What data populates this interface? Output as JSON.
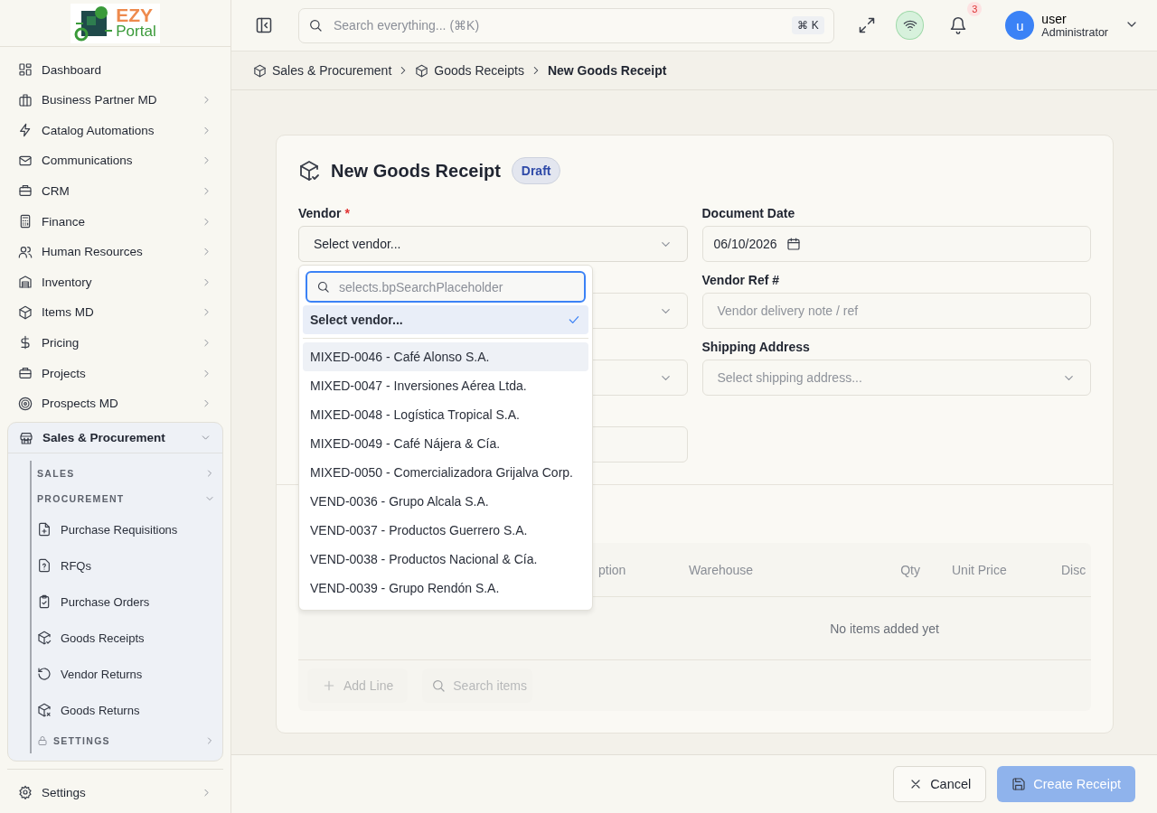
{
  "sidebar": {
    "logo": {
      "line_1": "EZY",
      "line_2": "Portal"
    },
    "items": [
      {
        "label": "Dashboard",
        "expandable": false
      },
      {
        "label": "Business Partner MD",
        "expandable": true
      },
      {
        "label": "Catalog Automations",
        "expandable": true
      },
      {
        "label": "Communications",
        "expandable": true
      },
      {
        "label": "CRM",
        "expandable": true
      },
      {
        "label": "Finance",
        "expandable": true
      },
      {
        "label": "Human Resources",
        "expandable": true
      },
      {
        "label": "Inventory",
        "expandable": true
      },
      {
        "label": "Items MD",
        "expandable": true
      },
      {
        "label": "Pricing",
        "expandable": true
      },
      {
        "label": "Projects",
        "expandable": true
      },
      {
        "label": "Prospects MD",
        "expandable": true
      }
    ],
    "group": {
      "label": "Sales & Procurement",
      "expanded": true,
      "sections": [
        {
          "label": "SALES",
          "expanded": false,
          "locked": false
        },
        {
          "label": "PROCUREMENT",
          "expanded": true,
          "locked": false,
          "children": [
            {
              "label": "Purchase Requisitions"
            },
            {
              "label": "RFQs"
            },
            {
              "label": "Purchase Orders"
            },
            {
              "label": "Goods Receipts"
            },
            {
              "label": "Vendor Returns"
            },
            {
              "label": "Goods Returns"
            }
          ]
        },
        {
          "label": "SETTINGS",
          "expanded": false,
          "locked": true
        }
      ]
    },
    "footer_item": {
      "label": "Settings",
      "expandable": true
    }
  },
  "header": {
    "search_placeholder": "Search everything... (⌘K)",
    "shortcut": "⌘ K",
    "notification_count": "3",
    "user": {
      "avatar": "u",
      "name": "user",
      "role": "Administrator"
    }
  },
  "breadcrumbs": [
    {
      "label": "Sales & Procurement",
      "current": false
    },
    {
      "label": "Goods Receipts",
      "current": false
    },
    {
      "label": "New Goods Receipt",
      "current": true
    }
  ],
  "form": {
    "title": "New Goods Receipt",
    "status": "Draft",
    "fields": [
      {
        "label": "Vendor",
        "required_mark": "*",
        "kind": "select",
        "value": "Select vendor..."
      },
      {
        "label": "Document Date",
        "kind": "date",
        "value": "06/10/2026"
      },
      {
        "kind": "select"
      },
      {
        "label": "Vendor Ref #",
        "kind": "text",
        "placeholder": "Vendor delivery note / ref"
      },
      {
        "kind": "select"
      },
      {
        "label": "Shipping Address",
        "kind": "select",
        "placeholder": "Select shipping address..."
      },
      {
        "kind": "text"
      }
    ],
    "dropdown": {
      "search_placeholder": "selects.bpSearchPlaceholder",
      "options": [
        {
          "label": "Select vendor...",
          "selected": true,
          "highlighted": false
        },
        {
          "label": "MIXED-0046 - Café Alonso S.A.",
          "selected": false,
          "highlighted": true
        },
        {
          "label": "MIXED-0047 - Inversiones Aérea Ltda.",
          "selected": false,
          "highlighted": false
        },
        {
          "label": "MIXED-0048 - Logística Tropical S.A.",
          "selected": false,
          "highlighted": false
        },
        {
          "label": "MIXED-0049 - Café Nájera & Cía.",
          "selected": false,
          "highlighted": false
        },
        {
          "label": "MIXED-0050 - Comercializadora Grijalva Corp.",
          "selected": false,
          "highlighted": false
        },
        {
          "label": "VEND-0036 - Grupo Alcala S.A.",
          "selected": false,
          "highlighted": false
        },
        {
          "label": "VEND-0037 - Productos Guerrero S.A.",
          "selected": false,
          "highlighted": false
        },
        {
          "label": "VEND-0038 - Productos Nacional & Cía.",
          "selected": false,
          "highlighted": false
        },
        {
          "label": "VEND-0039 - Grupo Rendón S.A.",
          "selected": false,
          "highlighted": false
        }
      ]
    }
  },
  "lines_table": {
    "columns": [
      "ption",
      "Warehouse",
      "Qty",
      "Unit Price",
      "Disc"
    ],
    "empty_message": "No items added yet",
    "add_line": {
      "label": "Add Line",
      "disabled": true
    },
    "search_placeholder": "Search items"
  },
  "footer": {
    "cancel": "Cancel",
    "create": {
      "label": "Create Receipt",
      "disabled": true
    }
  }
}
